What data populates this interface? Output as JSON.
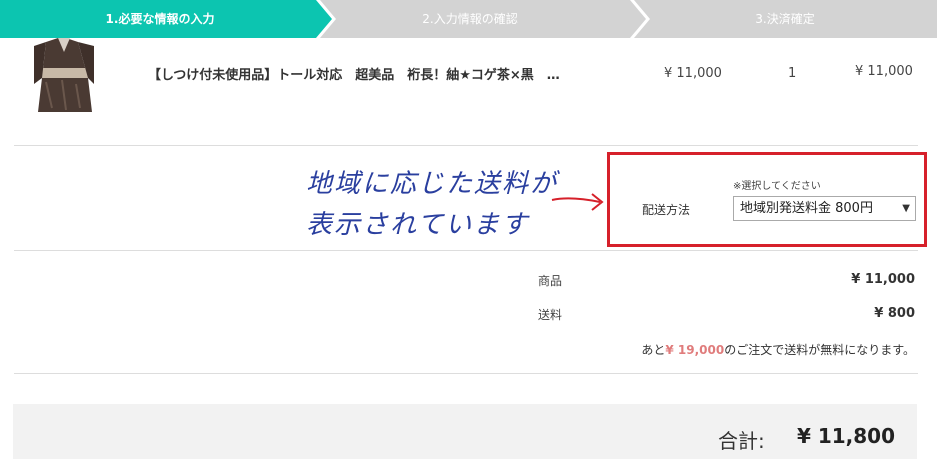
{
  "steps": [
    {
      "label": "1.必要な情報の入力",
      "state": "active"
    },
    {
      "label": "2.入力情報の確認",
      "state": "inactive"
    },
    {
      "label": "3.決済確定",
      "state": "inactive"
    }
  ],
  "colors": {
    "step_active": "#0cc5b0",
    "step_inactive": "#d3d3d3",
    "highlight_border": "#d6202a",
    "annotation_ink": "#2a3f9f",
    "free_amount": "#e07c7c"
  },
  "product": {
    "name": "【しつけ付未使用品】トール対応　超美品　裄長！紬★コゲ茶×黒　…",
    "price": "¥ 11,000",
    "quantity": "1",
    "subtotal": "¥ 11,000"
  },
  "annotation": {
    "line1": "地域に応じた送料が",
    "line2": "表示されています"
  },
  "shipping": {
    "note": "※選択してください",
    "label": "配送方法",
    "selected": "地域別発送料金 800円",
    "caret": "▼"
  },
  "summary": {
    "item_label": "商品",
    "item_value": "¥ 11,000",
    "shipping_label": "送料",
    "shipping_value": "¥ 800",
    "free_prefix": "あと",
    "free_amount": "¥ 19,000",
    "free_suffix": "のご注文で送料が無料になります。"
  },
  "total": {
    "label": "合計:",
    "value": "¥ 11,800"
  }
}
